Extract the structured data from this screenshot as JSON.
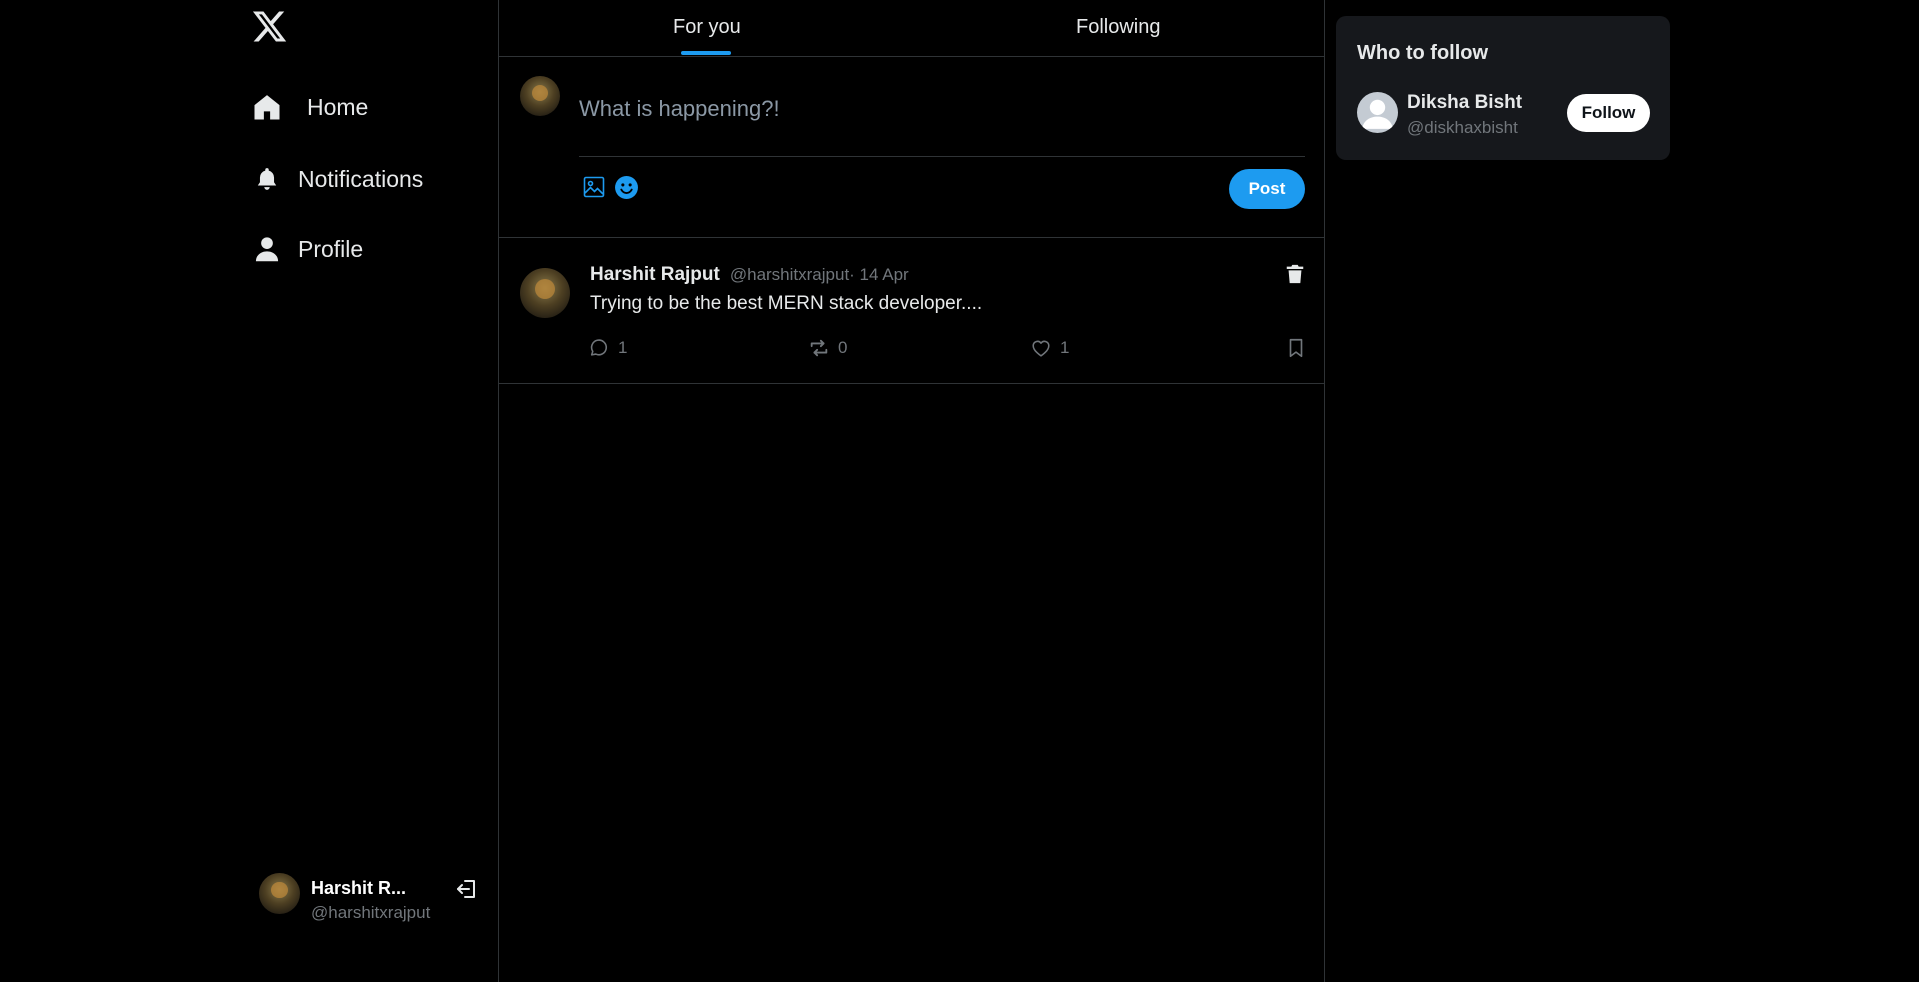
{
  "sidebar": {
    "logo": "x-logo-icon",
    "nav": [
      {
        "label": "Home",
        "icon": "home-icon"
      },
      {
        "label": "Notifications",
        "icon": "bell-icon"
      },
      {
        "label": "Profile",
        "icon": "user-icon"
      }
    ],
    "account": {
      "name": "Harshit R...",
      "handle": "@harshitxrajput",
      "logout_icon": "logout-icon"
    }
  },
  "main": {
    "tabs": [
      {
        "label": "For you",
        "active": true
      },
      {
        "label": "Following",
        "active": false
      }
    ],
    "composer": {
      "placeholder": "What is happening?!",
      "value": "",
      "post_label": "Post",
      "icons": [
        "image-icon",
        "emoji-icon"
      ]
    },
    "posts": [
      {
        "author": "Harshit Rajput",
        "handle": "@harshitxrajput",
        "date": " · 14 Apr",
        "text": "Trying to be the best MERN stack developer....",
        "replies": "1",
        "reposts": "0",
        "likes": "1"
      }
    ]
  },
  "right": {
    "who_to_follow": {
      "title": "Who to follow",
      "suggestions": [
        {
          "name": "Diksha Bisht",
          "handle": "@diskhaxbisht",
          "button": "Follow"
        }
      ]
    }
  },
  "colors": {
    "accent": "#1d9bf0",
    "background": "#000000",
    "text": "#e7e9ea",
    "muted": "#71767b",
    "border": "#2f3336",
    "card": "#16181c"
  }
}
